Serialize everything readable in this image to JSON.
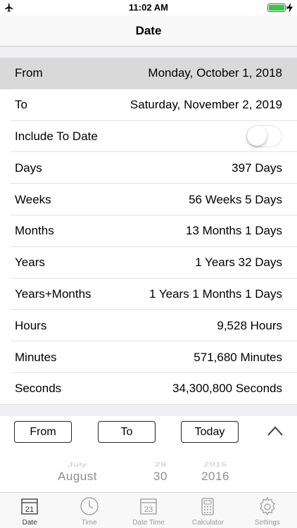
{
  "status_bar": {
    "time": "11:02 AM"
  },
  "nav": {
    "title": "Date"
  },
  "rows": [
    {
      "label": "From",
      "value": "Monday, October 1, 2018"
    },
    {
      "label": "To",
      "value": "Saturday, November 2, 2019"
    },
    {
      "label": "Include To Date",
      "toggle": false
    },
    {
      "label": "Days",
      "value": "397 Days"
    },
    {
      "label": "Weeks",
      "value": "56 Weeks 5 Days"
    },
    {
      "label": "Months",
      "value": "13 Months 1 Days"
    },
    {
      "label": "Years",
      "value": "1 Years 32 Days"
    },
    {
      "label": "Years+Months",
      "value": "1 Years 1 Months 1 Days"
    },
    {
      "label": "Hours",
      "value": "9,528 Hours"
    },
    {
      "label": "Minutes",
      "value": "571,680 Minutes"
    },
    {
      "label": "Seconds",
      "value": "34,300,800 Seconds"
    }
  ],
  "buttons": {
    "from": "From",
    "to": "To",
    "today": "Today"
  },
  "picker": {
    "month_prev": "July",
    "month_current": "August",
    "day_prev": "29",
    "day_current": "30",
    "year_prev": "2015",
    "year_current": "2016"
  },
  "tabs": [
    {
      "label": "Date",
      "icon": "calendar-icon",
      "badge": "21",
      "active": true
    },
    {
      "label": "Time",
      "icon": "clock-icon"
    },
    {
      "label": "Date Time",
      "icon": "calendar-icon",
      "badge": "23"
    },
    {
      "label": "Calculator",
      "icon": "calculator-icon"
    },
    {
      "label": "Settings",
      "icon": "gear-icon"
    }
  ],
  "colors": {
    "battery": "#2ecc40",
    "selected_row": "#d9d9d9",
    "group_bg": "#efeff4"
  }
}
